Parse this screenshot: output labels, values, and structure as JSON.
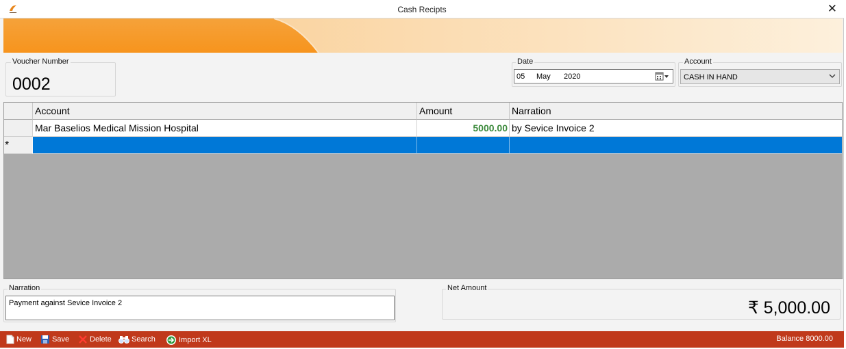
{
  "window": {
    "title": "Cash Recipts"
  },
  "colors": {
    "banner_orange": "#f7941d",
    "statusbar": "#c0391b",
    "selection": "#0078d7",
    "amount_text": "#3c8a3c"
  },
  "voucher": {
    "label": "Voucher Number",
    "value": "0002"
  },
  "date": {
    "label": "Date",
    "day": "05",
    "month": "May",
    "year": "2020"
  },
  "account": {
    "label": "Account",
    "selected": "CASH IN HAND"
  },
  "grid": {
    "columns": [
      "Account",
      "Amount",
      "Narration"
    ],
    "rows": [
      {
        "account": "Mar Baselios Medical Mission Hospital",
        "amount": "5000.00",
        "narration": "by Sevice Invoice 2"
      }
    ],
    "new_row_marker": "*"
  },
  "narration": {
    "label": "Narration",
    "value": "Payment  against Sevice Invoice 2"
  },
  "net_amount": {
    "label": "Net Amount",
    "value": "₹ 5,000.00"
  },
  "toolbar": {
    "new": "New",
    "save": "Save",
    "delete": "Delete",
    "search": "Search",
    "import": "Import XL",
    "balance": "Balance 8000.00"
  },
  "icons": [
    "app-icon",
    "close-icon",
    "calendar-icon",
    "chevron-down-icon",
    "new-document-icon",
    "save-disk-icon",
    "delete-x-icon",
    "binoculars-icon",
    "import-arrow-icon"
  ]
}
